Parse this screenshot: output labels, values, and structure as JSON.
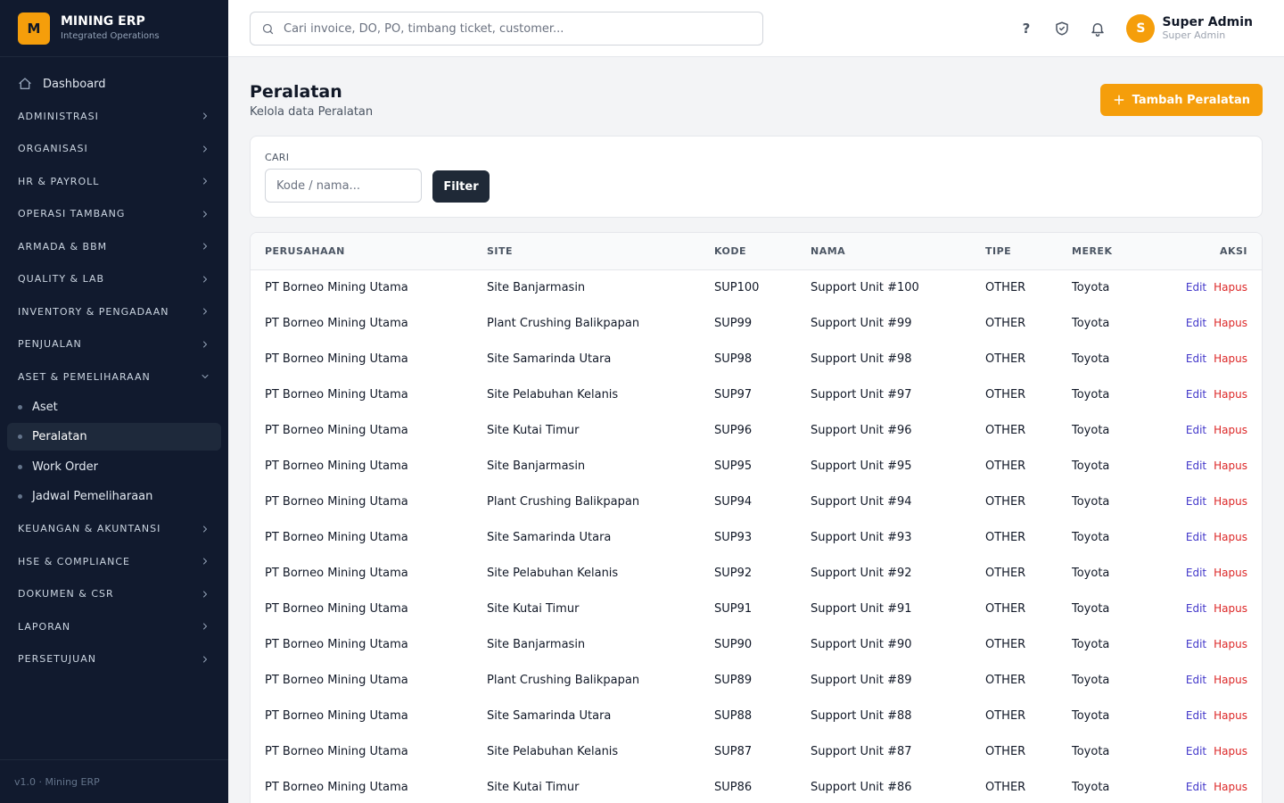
{
  "brand": {
    "logo_letter": "M",
    "name": "MINING ERP",
    "subtitle": "Integrated Operations"
  },
  "sidebar": {
    "dashboard_label": "Dashboard",
    "sections_before": [
      "ADMINISTRASI",
      "ORGANISASI",
      "HR & PAYROLL",
      "OPERASI TAMBANG",
      "ARMADA & BBM",
      "QUALITY & LAB",
      "INVENTORY & PENGADAAN",
      "PENJUALAN"
    ],
    "expanded_section": "ASET & PEMELIHARAAN",
    "sub_items": [
      "Aset",
      "Peralatan",
      "Work Order",
      "Jadwal Pemeliharaan"
    ],
    "active_sub_item": "Peralatan",
    "sections_after": [
      "KEUANGAN & AKUNTANSI",
      "HSE & COMPLIANCE",
      "DOKUMEN & CSR",
      "LAPORAN",
      "PERSETUJUAN"
    ],
    "footer": "v1.0 · Mining ERP"
  },
  "topbar": {
    "search_placeholder": "Cari invoice, DO, PO, timbang ticket, customer...",
    "user": {
      "initial": "S",
      "name": "Super Admin",
      "role": "Super Admin"
    }
  },
  "page": {
    "title": "Peralatan",
    "subtitle": "Kelola data Peralatan",
    "add_button": "Tambah Peralatan"
  },
  "filter": {
    "label": "CARI",
    "placeholder": "Kode / nama...",
    "button": "Filter"
  },
  "table": {
    "columns": [
      "PERUSAHAAN",
      "SITE",
      "KODE",
      "NAMA",
      "TIPE",
      "MEREK",
      "AKSI"
    ],
    "edit_label": "Edit",
    "delete_label": "Hapus",
    "rows": [
      [
        "PT Borneo Mining Utama",
        "Site Banjarmasin",
        "SUP100",
        "Support Unit #100",
        "OTHER",
        "Toyota"
      ],
      [
        "PT Borneo Mining Utama",
        "Plant Crushing Balikpapan",
        "SUP99",
        "Support Unit #99",
        "OTHER",
        "Toyota"
      ],
      [
        "PT Borneo Mining Utama",
        "Site Samarinda Utara",
        "SUP98",
        "Support Unit #98",
        "OTHER",
        "Toyota"
      ],
      [
        "PT Borneo Mining Utama",
        "Site Pelabuhan Kelanis",
        "SUP97",
        "Support Unit #97",
        "OTHER",
        "Toyota"
      ],
      [
        "PT Borneo Mining Utama",
        "Site Kutai Timur",
        "SUP96",
        "Support Unit #96",
        "OTHER",
        "Toyota"
      ],
      [
        "PT Borneo Mining Utama",
        "Site Banjarmasin",
        "SUP95",
        "Support Unit #95",
        "OTHER",
        "Toyota"
      ],
      [
        "PT Borneo Mining Utama",
        "Plant Crushing Balikpapan",
        "SUP94",
        "Support Unit #94",
        "OTHER",
        "Toyota"
      ],
      [
        "PT Borneo Mining Utama",
        "Site Samarinda Utara",
        "SUP93",
        "Support Unit #93",
        "OTHER",
        "Toyota"
      ],
      [
        "PT Borneo Mining Utama",
        "Site Pelabuhan Kelanis",
        "SUP92",
        "Support Unit #92",
        "OTHER",
        "Toyota"
      ],
      [
        "PT Borneo Mining Utama",
        "Site Kutai Timur",
        "SUP91",
        "Support Unit #91",
        "OTHER",
        "Toyota"
      ],
      [
        "PT Borneo Mining Utama",
        "Site Banjarmasin",
        "SUP90",
        "Support Unit #90",
        "OTHER",
        "Toyota"
      ],
      [
        "PT Borneo Mining Utama",
        "Plant Crushing Balikpapan",
        "SUP89",
        "Support Unit #89",
        "OTHER",
        "Toyota"
      ],
      [
        "PT Borneo Mining Utama",
        "Site Samarinda Utara",
        "SUP88",
        "Support Unit #88",
        "OTHER",
        "Toyota"
      ],
      [
        "PT Borneo Mining Utama",
        "Site Pelabuhan Kelanis",
        "SUP87",
        "Support Unit #87",
        "OTHER",
        "Toyota"
      ],
      [
        "PT Borneo Mining Utama",
        "Site Kutai Timur",
        "SUP86",
        "Support Unit #86",
        "OTHER",
        "Toyota"
      ]
    ]
  },
  "colors": {
    "accent": "#f59e0b",
    "sidebar_bg": "#111a2e",
    "edit": "#4338ca",
    "delete": "#dc2626"
  },
  "icons": [
    "home-icon",
    "chevron-right-icon",
    "chevron-down-icon",
    "search-icon",
    "help-icon",
    "shield-check-icon",
    "bell-icon",
    "plus-icon"
  ]
}
